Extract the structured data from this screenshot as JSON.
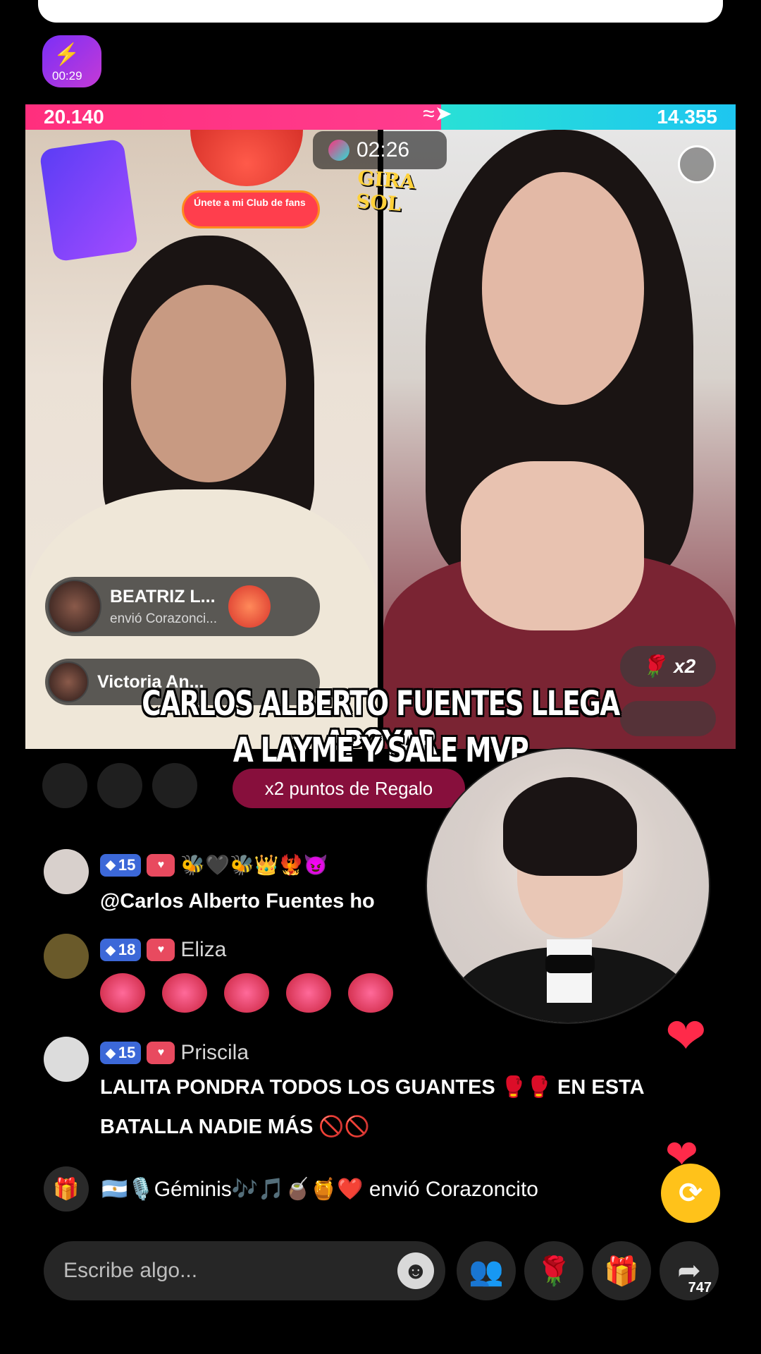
{
  "header": {
    "badge_timer": "00:29"
  },
  "battle": {
    "score_left": "20.140",
    "score_right": "14.355",
    "timer": "02:26",
    "club_button": "Únete a mi Club de fans",
    "sticker_text": "GIRA SOL",
    "multiplier": "x2",
    "bonus_label": "x2 puntos de Regalo"
  },
  "gift_notices": [
    {
      "name": "BEATRIZ L...",
      "action": "envió Corazonci..."
    },
    {
      "name": "Victoria An...",
      "action": ""
    }
  ],
  "caption": {
    "line1": "CARLOS ALBERTO FUENTES LLEGA APOYAR",
    "line2": "A LAYME Y SALE MVP"
  },
  "comments": [
    {
      "level": "15",
      "username": "",
      "emojis": "🐝🖤🐝👑🐦‍🔥😈",
      "message": "@Carlos Alberto Fuentes ho"
    },
    {
      "level": "18",
      "username": "Eliza",
      "emojis": "",
      "message": ""
    },
    {
      "level": "15",
      "username": "Priscila",
      "emojis": "",
      "message": "LALITA PONDRA TODOS LOS GUANTES 🥊🥊 EN ESTA BATALLA NADIE MÁS 🚫🚫"
    }
  ],
  "gift_line": "🇦🇷🎙️Géminis🎶🎵🧉🍯❤️ envió Corazoncito",
  "bottom_bar": {
    "input_placeholder": "Escribe algo...",
    "share_count": "747"
  },
  "colors": {
    "left_team": "#ff2f7d",
    "right_team": "#29e0d6",
    "accent": "#ffc21a"
  }
}
